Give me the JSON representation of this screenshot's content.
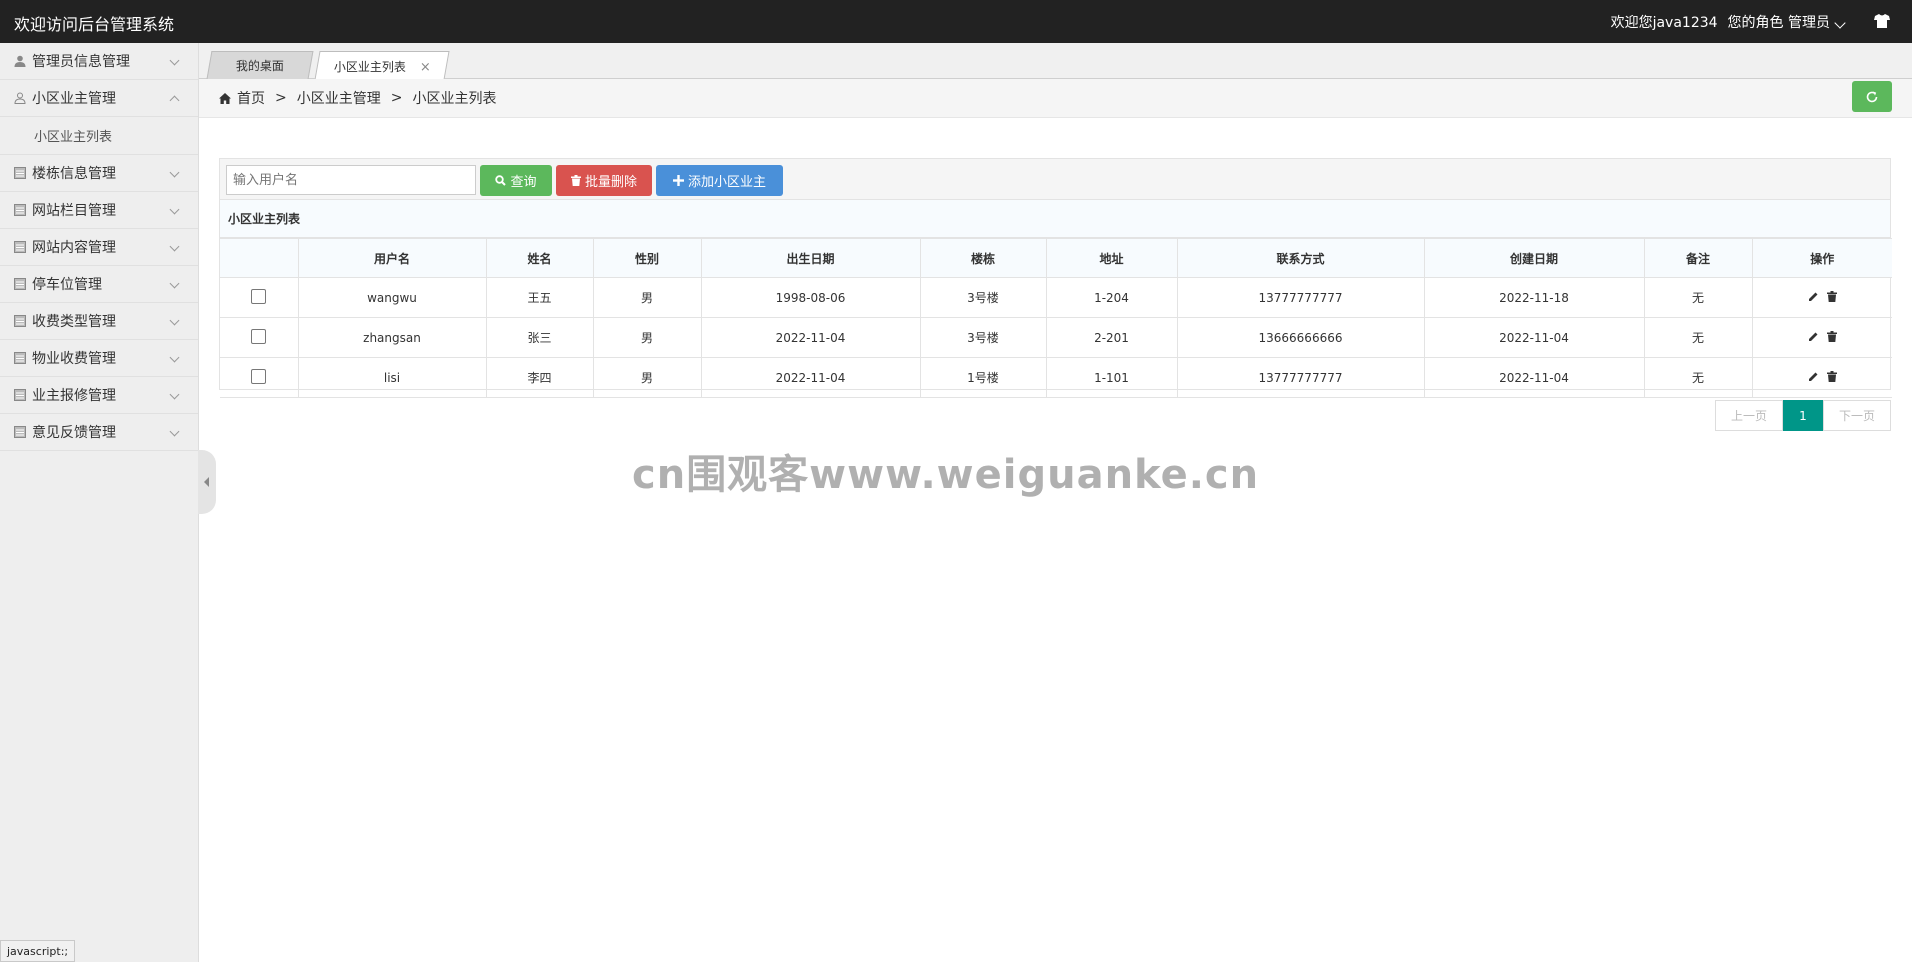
{
  "header": {
    "title": "欢迎访问后台管理系统",
    "welcome": "欢迎您java1234",
    "role": "您的角色 管理员"
  },
  "sidebar": {
    "items": [
      {
        "label": "管理员信息管理",
        "icon": "user-icon",
        "expanded": false
      },
      {
        "label": "小区业主管理",
        "icon": "user-outline-icon",
        "expanded": true,
        "children": [
          {
            "label": "小区业主列表"
          }
        ]
      },
      {
        "label": "楼栋信息管理",
        "icon": "list-icon",
        "expanded": false
      },
      {
        "label": "网站栏目管理",
        "icon": "list-icon",
        "expanded": false
      },
      {
        "label": "网站内容管理",
        "icon": "list-icon",
        "expanded": false
      },
      {
        "label": "停车位管理",
        "icon": "list-icon",
        "expanded": false
      },
      {
        "label": "收费类型管理",
        "icon": "list-icon",
        "expanded": false
      },
      {
        "label": "物业收费管理",
        "icon": "list-icon",
        "expanded": false
      },
      {
        "label": "业主报修管理",
        "icon": "list-icon",
        "expanded": false
      },
      {
        "label": "意见反馈管理",
        "icon": "list-icon",
        "expanded": false
      }
    ]
  },
  "tabs": [
    {
      "label": "我的桌面",
      "active": false
    },
    {
      "label": "小区业主列表",
      "active": true,
      "close": "×"
    }
  ],
  "breadcrumb": {
    "items": [
      "首页",
      "小区业主管理",
      "小区业主列表"
    ],
    "separator": ">"
  },
  "toolbar": {
    "search_placeholder": "输入用户名",
    "search_label": "查询",
    "batch_delete_label": "批量删除",
    "add_label": "添加小区业主"
  },
  "table": {
    "title": "小区业主列表",
    "columns": [
      "",
      "用户名",
      "姓名",
      "性别",
      "出生日期",
      "楼栋",
      "地址",
      "联系方式",
      "创建日期",
      "备注",
      "操作"
    ],
    "rows": [
      {
        "username": "wangwu",
        "name": "王五",
        "gender": "男",
        "birth": "1998-08-06",
        "building": "3号楼",
        "address": "1-204",
        "phone": "13777777777",
        "created": "2022-11-18",
        "note": "无"
      },
      {
        "username": "zhangsan",
        "name": "张三",
        "gender": "男",
        "birth": "2022-11-04",
        "building": "3号楼",
        "address": "2-201",
        "phone": "13666666666",
        "created": "2022-11-04",
        "note": "无"
      },
      {
        "username": "lisi",
        "name": "李四",
        "gender": "男",
        "birth": "2022-11-04",
        "building": "1号楼",
        "address": "1-101",
        "phone": "13777777777",
        "created": "2022-11-04",
        "note": "无"
      }
    ]
  },
  "pagination": {
    "prev": "上一页",
    "current": "1",
    "next": "下一页"
  },
  "watermark": "cn围观客www.weiguanke.cn",
  "statusbar": "javascript:;",
  "colors": {
    "header_bg": "#222222",
    "green": "#5cb85c",
    "red": "#d9534f",
    "blue": "#4a90d9",
    "teal": "#009688"
  }
}
